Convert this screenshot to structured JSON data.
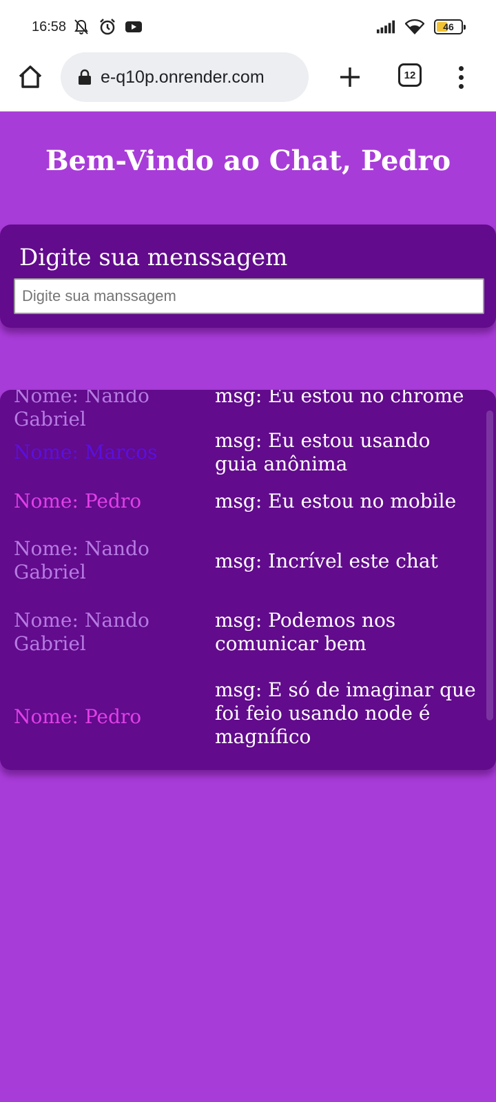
{
  "status_bar": {
    "time": "16:58",
    "battery_level": "46",
    "icons": [
      "bell-off-icon",
      "alarm-icon",
      "youtube-icon",
      "signal-icon",
      "wifi-icon",
      "battery-icon"
    ]
  },
  "browser": {
    "url": "e-q10p.onrender.com",
    "tab_count": "12"
  },
  "page": {
    "title": "Bem-Vindo ao Chat, Pedro",
    "message_label": "Digite sua menssagem",
    "message_placeholder": "Digite sua manssagem"
  },
  "messages": [
    {
      "name": "Nome: Nando Gabriel",
      "text": "msg: Eu estou no chrome",
      "color": "#b77be3"
    },
    {
      "name": "Nome: Marcos",
      "text": "msg: Eu estou usando guia anônima",
      "color": "#5a10e0"
    },
    {
      "name": "Nome: Pedro",
      "text": "msg: Eu estou no mobile",
      "color": "#e040e8"
    },
    {
      "name": "Nome: Nando Gabriel",
      "text": "msg: Incrível este chat",
      "color": "#b77be3"
    },
    {
      "name": "Nome: Nando Gabriel",
      "text": "msg: Podemos nos comunicar bem",
      "color": "#b77be3"
    },
    {
      "name": "Nome: Pedro",
      "text": "msg: E só de imaginar que foi feio usando node é magnífico",
      "color": "#e040e8"
    }
  ],
  "colors": {
    "page_background": "#a83cd8",
    "card_background": "#620b8c"
  }
}
